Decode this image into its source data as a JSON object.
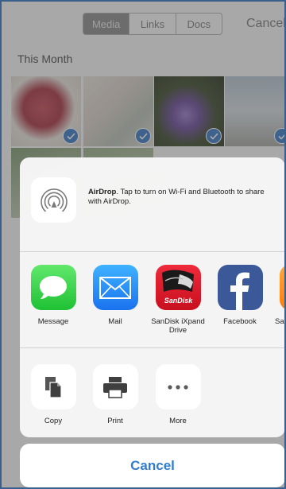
{
  "segments": [
    "Media",
    "Links",
    "Docs"
  ],
  "top_cancel": "Cancel",
  "section_title": "This Month",
  "airdrop": {
    "title": "AirDrop",
    "message": ". Tap to turn on Wi-Fi and Bluetooth to share with AirDrop."
  },
  "apps": [
    {
      "label": "Message",
      "icon": "message-icon"
    },
    {
      "label": "Mail",
      "icon": "mail-icon"
    },
    {
      "label": "SanDisk iXpand Drive",
      "icon": "sandisk-icon",
      "brand_text": "SanDisk"
    },
    {
      "label": "Facebook",
      "icon": "facebook-icon"
    },
    {
      "label": "Sa",
      "icon": "partial-app-icon"
    }
  ],
  "actions": [
    {
      "label": "Copy",
      "icon": "copy-icon"
    },
    {
      "label": "Print",
      "icon": "print-icon"
    },
    {
      "label": "More",
      "icon": "more-icon"
    }
  ],
  "cancel_button": "Cancel",
  "colors": {
    "accent": "#2f7cd0",
    "message_green": "#3ec84b",
    "mail_blue": "#2a8ff5",
    "facebook_blue": "#3b5998",
    "check_blue": "#3a79c6"
  }
}
